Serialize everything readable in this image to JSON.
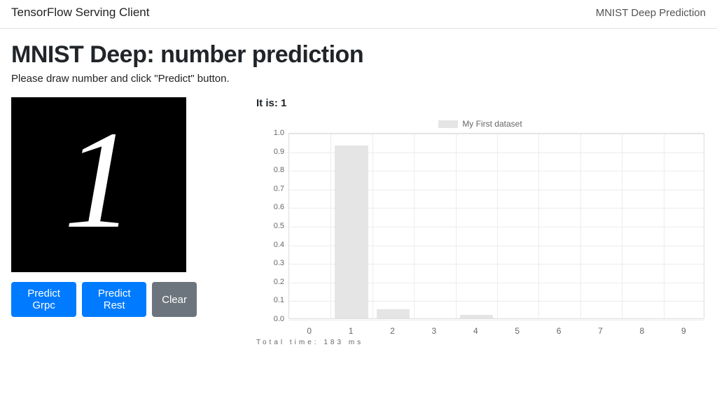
{
  "navbar": {
    "brand": "TensorFlow Serving Client",
    "page_link": "MNIST Deep Prediction"
  },
  "headline": "MNIST Deep: number prediction",
  "subtitle": "Please draw number and click \"Predict\" button.",
  "drawn_digit_glyph": "1",
  "buttons": {
    "predict_grpc": "Predict Grpc",
    "predict_rest": "Predict Rest",
    "clear": "Clear"
  },
  "result": {
    "prefix": "It is: ",
    "value": "1"
  },
  "chart_data": {
    "type": "bar",
    "title": "",
    "legend": "My First dataset",
    "xlabel": "",
    "ylabel": "",
    "ylim": [
      0,
      1.0
    ],
    "yticks": [
      0,
      0.1,
      0.2,
      0.3,
      0.4,
      0.5,
      0.6,
      0.7,
      0.8,
      0.9,
      1.0
    ],
    "categories": [
      "0",
      "1",
      "2",
      "3",
      "4",
      "5",
      "6",
      "7",
      "8",
      "9"
    ],
    "values": [
      0.0,
      0.93,
      0.05,
      0.0,
      0.02,
      0.0,
      0.0,
      0.0,
      0.0,
      0.0
    ]
  },
  "timing_text": "Total time: 183 ms",
  "colors": {
    "primary": "#007bff",
    "secondary": "#6c757d",
    "bar_fill": "#e5e5e5"
  }
}
